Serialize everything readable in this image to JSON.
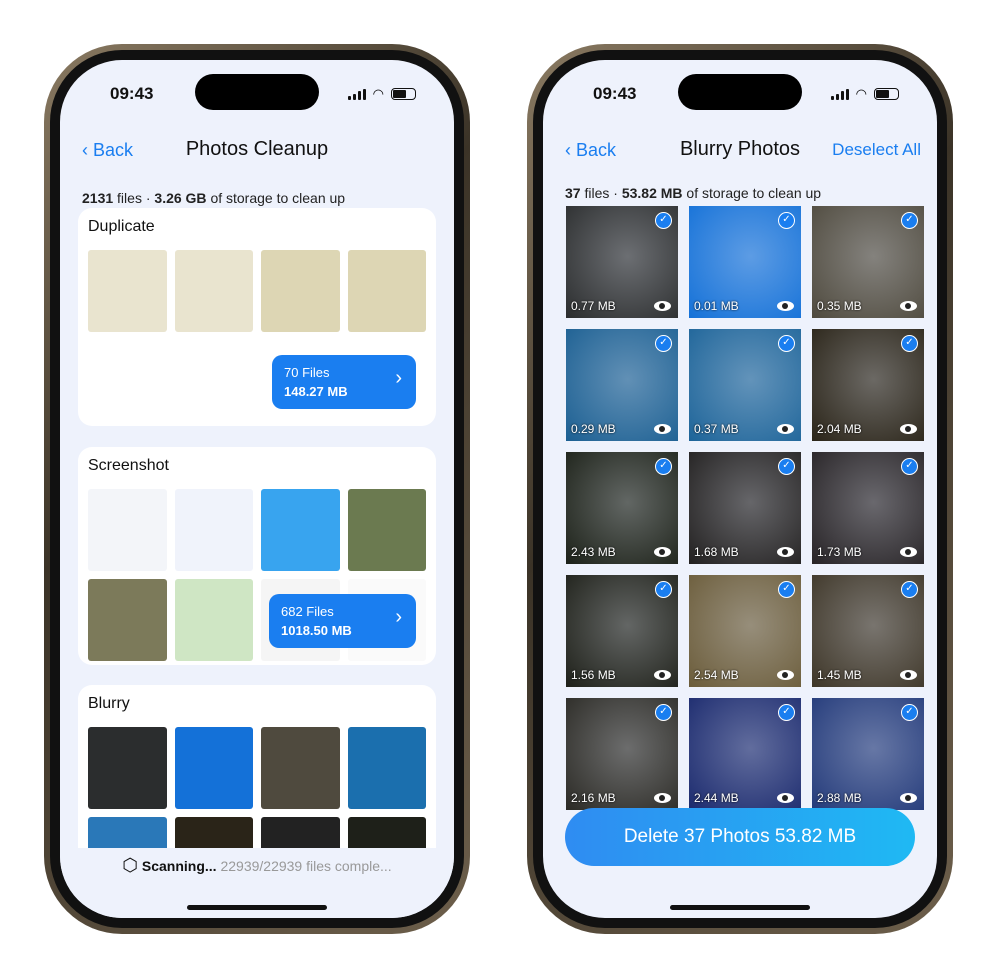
{
  "left": {
    "time": "09:43",
    "nav": {
      "back": "Back",
      "title": "Photos Cleanup"
    },
    "summary": {
      "count": "2131",
      "count_unit": "files",
      "size": "3.26 GB",
      "suffix": "of storage to clean up"
    },
    "cards": [
      {
        "title": "Duplicate",
        "badge_files": "70 Files",
        "badge_size": "148.27 MB"
      },
      {
        "title": "Screenshot",
        "badge_files": "682 Files",
        "badge_size": "1018.50 MB"
      },
      {
        "title": "Blurry"
      }
    ],
    "scan": {
      "label": "Scanning...",
      "progress": "22939/22939 files comple..."
    }
  },
  "right": {
    "time": "09:43",
    "nav": {
      "back": "Back",
      "title": "Blurry Photos",
      "action": "Deselect All"
    },
    "summary": {
      "count": "37",
      "count_unit": "files",
      "size": "53.82 MB",
      "suffix": "of storage to clean up"
    },
    "photos": [
      {
        "size": "0.77 MB",
        "color": "#2b2d2e"
      },
      {
        "size": "0.01 MB",
        "color": "#1471d8"
      },
      {
        "size": "0.35 MB",
        "color": "#4f4a3e"
      },
      {
        "size": "0.29 MB",
        "color": "#1b5f92"
      },
      {
        "size": "0.37 MB",
        "color": "#1d6499"
      },
      {
        "size": "2.04 MB",
        "color": "#2a2418"
      },
      {
        "size": "2.43 MB",
        "color": "#1c2118"
      },
      {
        "size": "1.68 MB",
        "color": "#222020"
      },
      {
        "size": "1.73 MB",
        "color": "#272326"
      },
      {
        "size": "1.56 MB",
        "color": "#1e2019"
      },
      {
        "size": "2.54 MB",
        "color": "#6b5c3a"
      },
      {
        "size": "1.45 MB",
        "color": "#3e3628"
      },
      {
        "size": "2.16 MB",
        "color": "#2b2a25"
      },
      {
        "size": "2.44 MB",
        "color": "#1b2a6e"
      },
      {
        "size": "2.88 MB",
        "color": "#233a7a"
      }
    ],
    "delete_button": "Delete 37 Photos 53.82 MB"
  }
}
